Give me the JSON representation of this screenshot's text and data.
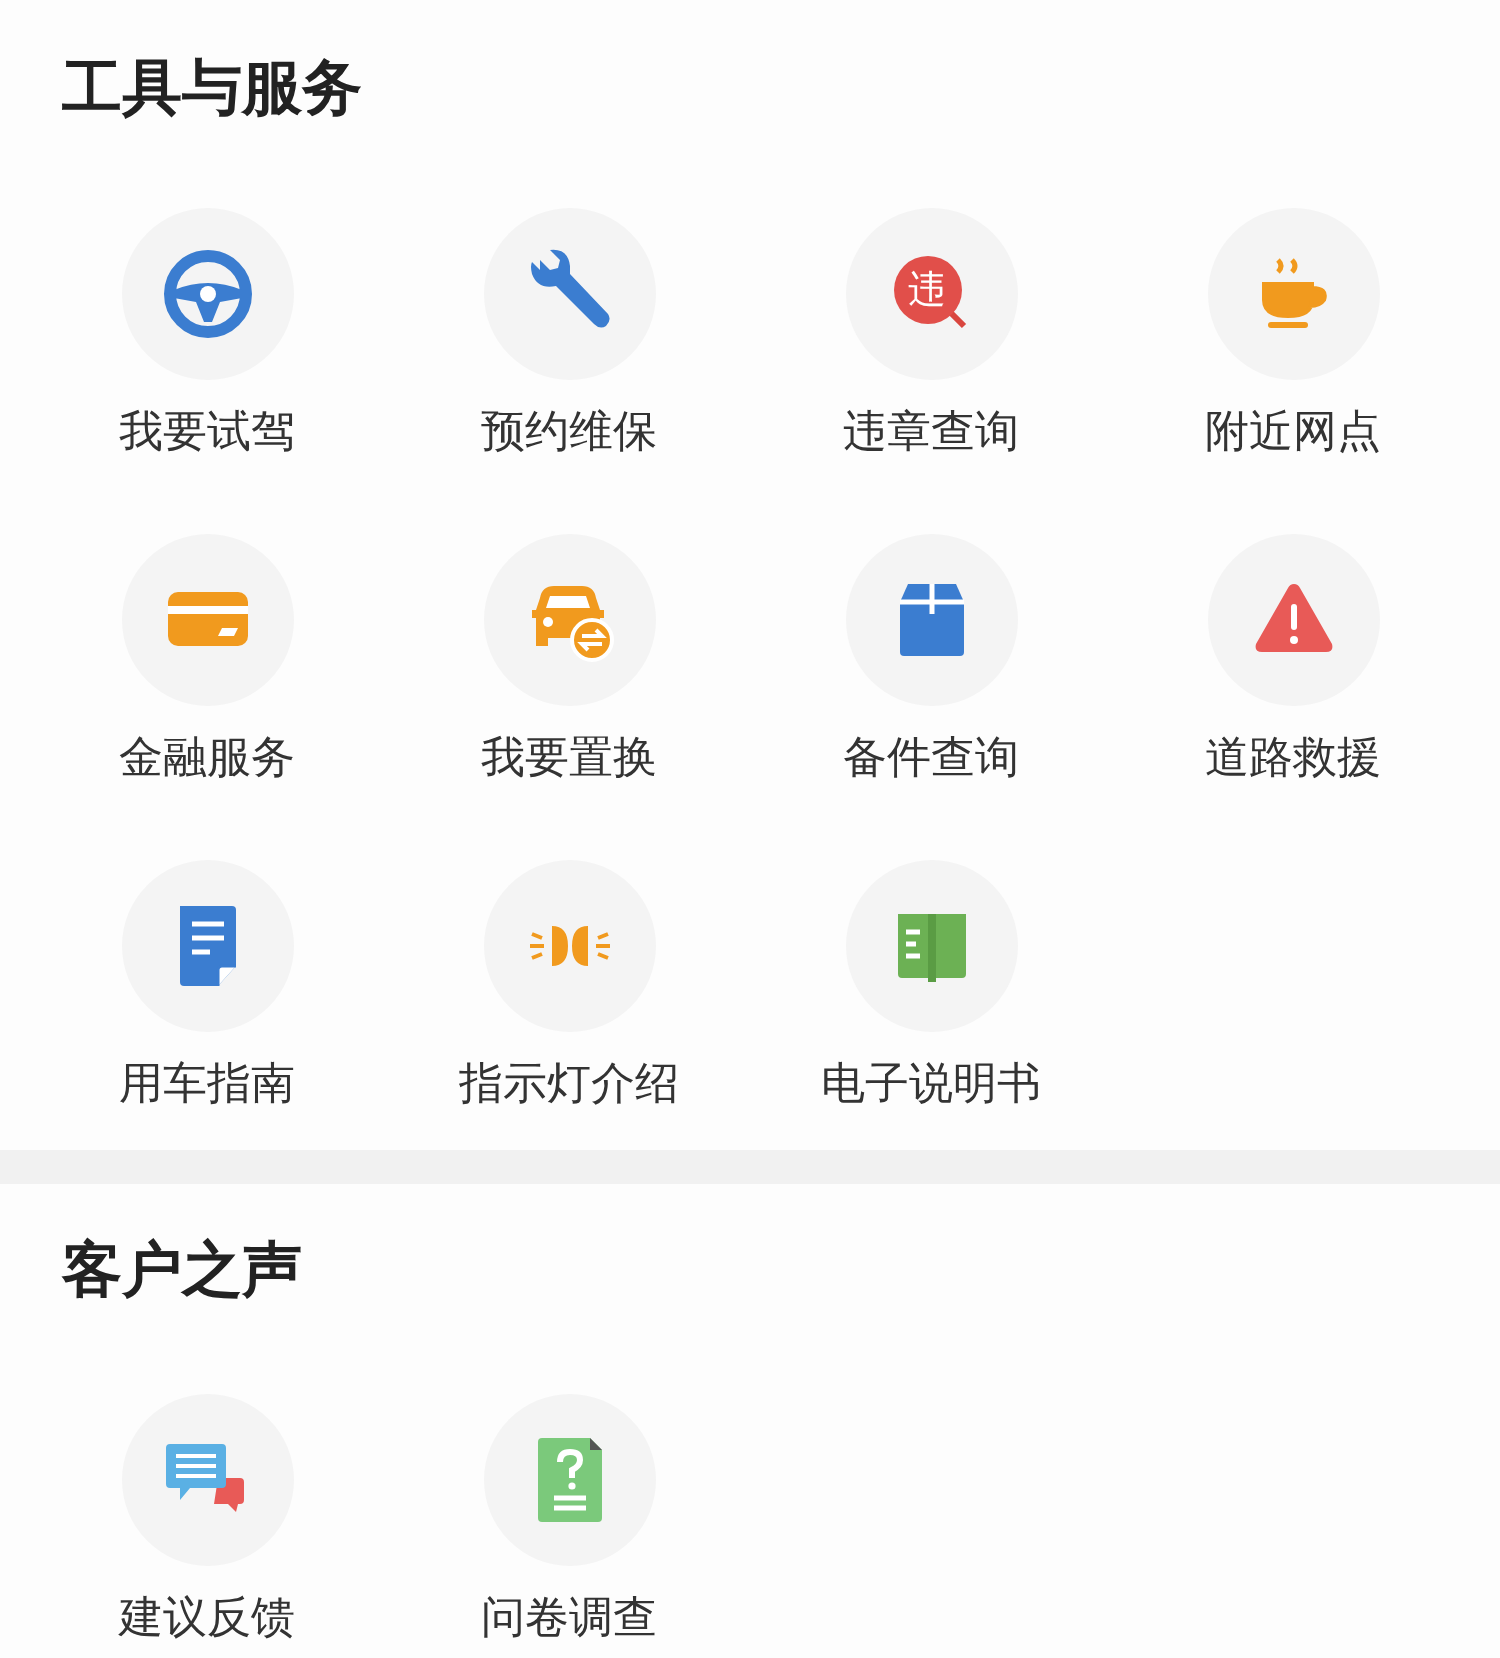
{
  "sections": [
    {
      "title": "工具与服务",
      "items": [
        {
          "label": "我要试驾"
        },
        {
          "label": "预约维保"
        },
        {
          "label": "违章查询",
          "icon_text": "违"
        },
        {
          "label": "附近网点"
        },
        {
          "label": "金融服务"
        },
        {
          "label": "我要置换"
        },
        {
          "label": "备件查询"
        },
        {
          "label": "道路救援"
        },
        {
          "label": "用车指南"
        },
        {
          "label": "指示灯介绍"
        },
        {
          "label": "电子说明书"
        }
      ]
    },
    {
      "title": "客户之声",
      "items": [
        {
          "label": "建议反馈"
        },
        {
          "label": "问卷调查"
        }
      ]
    }
  ]
}
